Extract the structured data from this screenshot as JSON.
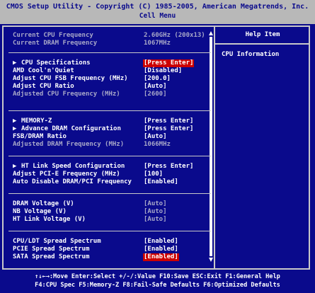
{
  "header": {
    "title": "CMOS Setup Utility - Copyright (C) 1985-2005, American Megatrends, Inc.",
    "subtitle": "Cell Menu"
  },
  "help": {
    "title": "Help Item",
    "text": "CPU Information"
  },
  "info": [
    {
      "label": "Current CPU Frequency",
      "value": "2.60GHz (200x13)"
    },
    {
      "label": "Current DRAM Frequency",
      "value": "1067MHz"
    }
  ],
  "settings": [
    {
      "label": "CPU Specifications",
      "value": "[Press Enter]",
      "submenu": true
    },
    {
      "label": "AMD Cool'n'Quiet",
      "value": "[Disabled]"
    },
    {
      "label": "Adjust CPU FSB Frequency (MHz)",
      "value": "[200.0]"
    },
    {
      "label": "Adjust CPU Ratio",
      "value": "[Auto]"
    },
    {
      "label": "Adjusted CPU Frequency (MHz)",
      "value": "[2600]"
    },
    {
      "label": "MEMORY-Z",
      "value": "[Press Enter]",
      "submenu": true
    },
    {
      "label": "Advance DRAM Configuration",
      "value": "[Press Enter]",
      "submenu": true
    },
    {
      "label": "FSB/DRAM Ratio",
      "value": "[Auto]"
    },
    {
      "label": "Adjusted DRAM Frequency (MHz)",
      "value": "1066MHz"
    },
    {
      "label": "HT Link Speed Configuration",
      "value": "[Press Enter]",
      "submenu": true
    },
    {
      "label": "Adjust PCI-E Frequency (MHz)",
      "value": "[100]"
    },
    {
      "label": "Auto Disable DRAM/PCI Frequency",
      "value": "[Enabled]"
    },
    {
      "label": "DRAM Voltage (V)",
      "value": "[Auto]"
    },
    {
      "label": "NB Voltage (V)",
      "value": "[Auto]"
    },
    {
      "label": "HT Link Voltage (V)",
      "value": "[Auto]"
    },
    {
      "label": "CPU/LDT Spread Spectrum",
      "value": "[Enabled]"
    },
    {
      "label": "PCIE Spread Spectrum",
      "value": "[Enabled]"
    },
    {
      "label": "SATA Spread Spectrum",
      "value": "[Enabled]"
    }
  ],
  "footer": {
    "line1": "↑↓←→:Move  Enter:Select  +/-/:Value  F10:Save  ESC:Exit  F1:General Help",
    "line2": "F4:CPU Spec  F5:Memory-Z  F8:Fail-Safe Defaults  F6:Optimized Defaults"
  },
  "colors": {
    "background": "#0a0a8c",
    "header_bg": "#b8b8b8",
    "highlight": "#cc0000",
    "disabled_text": "#a8a8c8"
  },
  "icons": {
    "submenu": "triangle-right-icon",
    "scroll_up": "scroll-up-arrow-icon",
    "scroll_down": "scroll-down-arrow-icon"
  }
}
